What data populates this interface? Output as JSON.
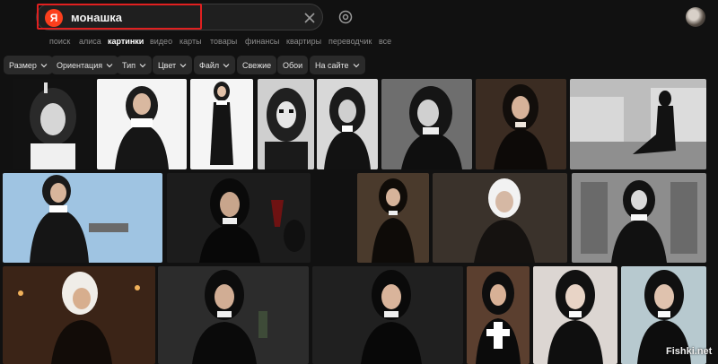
{
  "header": {
    "logo_letter": "Я",
    "search_query": "монашка"
  },
  "services": [
    {
      "label": "поиск",
      "active": false
    },
    {
      "label": "алиса",
      "active": false
    },
    {
      "label": "картинки",
      "active": true
    },
    {
      "label": "видео",
      "active": false
    },
    {
      "label": "карты",
      "active": false
    },
    {
      "label": "товары",
      "active": false
    },
    {
      "label": "финансы",
      "active": false
    },
    {
      "label": "квартиры",
      "active": false
    },
    {
      "label": "переводчик",
      "active": false
    },
    {
      "label": "все",
      "active": false
    }
  ],
  "filters": [
    {
      "label": "Размер",
      "dropdown": true
    },
    {
      "label": "Ориентация",
      "dropdown": true
    },
    {
      "label": "Тип",
      "dropdown": true
    },
    {
      "label": "Цвет",
      "dropdown": true
    },
    {
      "label": "Файл",
      "dropdown": true
    },
    {
      "label": "Свежие",
      "dropdown": false
    },
    {
      "label": "Обои",
      "dropdown": false
    },
    {
      "label": "На сайте",
      "dropdown": true
    }
  ],
  "results_icon_names": [
    "clear-icon",
    "camera-icon",
    "chevron-down-icon"
  ],
  "watermark": "Fishki.net",
  "colors": {
    "background": "#111111",
    "chip": "#2a2a2a",
    "brand": "#fc3f1d",
    "highlight_box": "#e02020"
  }
}
